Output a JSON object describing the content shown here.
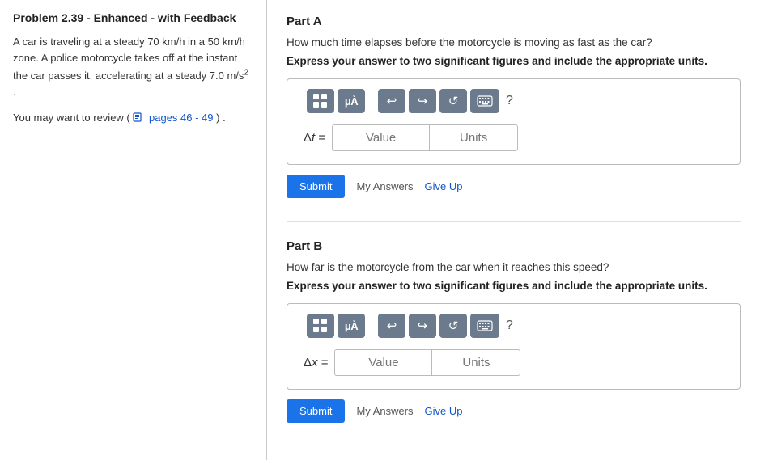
{
  "left": {
    "title": "Problem 2.39 - Enhanced - with Feedback",
    "problem_text_line1": "A car is traveling at a steady 70 km/h in a",
    "problem_text_line2": "50 km/h zone. A police motorcycle takes off at",
    "problem_text_line3": "the instant the car passes it, accelerating at a",
    "problem_text_line4": "steady 7.0 m/s² .",
    "review_prefix": "You may want to review (",
    "review_link": "pages 46 - 49",
    "review_suffix": ") ."
  },
  "right": {
    "partA": {
      "title": "Part A",
      "question": "How much time elapses before the motorcycle is moving as fast as the car?",
      "instruction": "Express your answer to two significant figures and include the appropriate units.",
      "label": "Δt =",
      "value_placeholder": "Value",
      "units_placeholder": "Units",
      "submit_label": "Submit",
      "my_answers_label": "My Answers",
      "give_up_label": "Give Up"
    },
    "partB": {
      "title": "Part B",
      "question": "How far is the motorcycle from the car when it reaches this speed?",
      "instruction": "Express your answer to two significant figures and include the appropriate units.",
      "label": "Δx =",
      "value_placeholder": "Value",
      "units_placeholder": "Units",
      "submit_label": "Submit",
      "my_answers_label": "My Answers",
      "give_up_label": "Give Up"
    },
    "toolbar": {
      "undo_title": "Undo",
      "redo_title": "Redo",
      "reset_title": "Reset",
      "keyboard_title": "Keyboard",
      "help_title": "Help"
    }
  }
}
